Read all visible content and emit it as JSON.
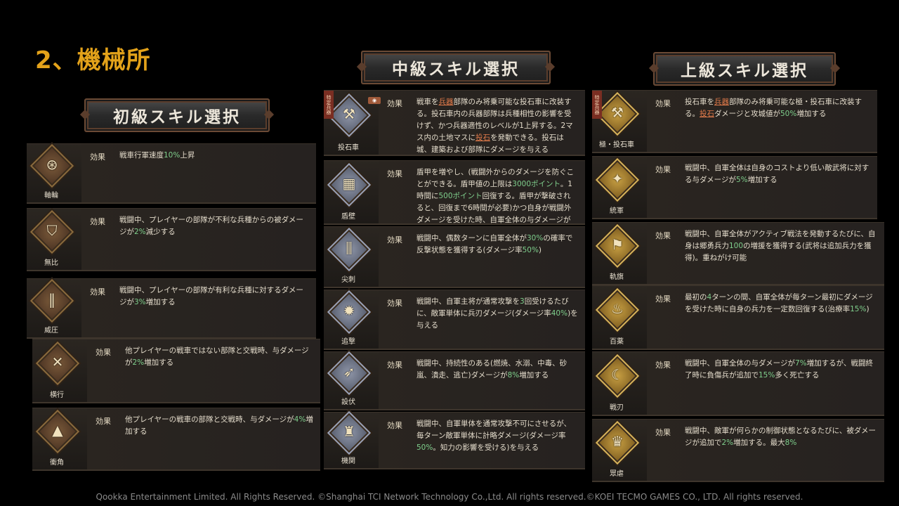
{
  "page_title": "2、機械所",
  "headers": {
    "basic": "初級スキル選択",
    "intermediate": "中級スキル選択",
    "advanced": "上級スキル選択"
  },
  "effect_label": "効果",
  "side_tag": "特定兵器",
  "basic": [
    {
      "name": "軸輪",
      "icon": "wheel-icon",
      "pre": "戦車行軍速度",
      "hl": "10%",
      "post": "上昇"
    },
    {
      "name": "無比",
      "icon": "shield-icon",
      "pre": "戦闘中、プレイヤーの部隊が不利な兵種からの被ダメージが",
      "hl": "2%",
      "post": "減少する"
    },
    {
      "name": "威圧",
      "icon": "double-blade-icon",
      "pre": "戦闘中、プレイヤーの部隊が有利な兵種に対するダメージが",
      "hl": "3%",
      "post": "増加する"
    },
    {
      "name": "横行",
      "icon": "crossed-swords-icon",
      "pre": "他プレイヤーの戦車ではない部隊と交戦時、与ダメージが",
      "hl": "2%",
      "post": "増加する"
    },
    {
      "name": "衝角",
      "icon": "spike-icon",
      "pre": "他プレイヤーの戦車の部隊と交戦時、与ダメージが",
      "hl": "4%",
      "post": "増加する"
    }
  ],
  "intermediate": [
    {
      "name": "投石車",
      "icon": "catapult-icon",
      "parts": [
        "戦車を",
        "兵器",
        "部隊のみ将乗可能な投石車に改装する。投石車内の兵器部隊は兵種相性の影響を受けず、かつ兵器適性のレベルが1上昇する。2マス内の土地マスに",
        "投石",
        "を発動できる。投石は城、建築および部隊にダメージを与える"
      ]
    },
    {
      "name": "盾壁",
      "icon": "shield-wall-icon",
      "parts": [
        "盾甲を増やし、(戦闘外からのダメージを防ぐことができる。盾甲値の上限は",
        "3000ポイント",
        "。1時間に",
        "500ポイント",
        "回復する。盾甲が撃破されると、回復まで6時間が必要)かつ自身が戦闘外ダメージを受けた時、自軍全体の与ダメージが",
        "8%",
        "上昇する"
      ]
    },
    {
      "name": "尖刺",
      "icon": "spikes-icon",
      "parts": [
        "戦闘中、偶数ターンに自軍全体が",
        "30%",
        "の確率で反撃状態を獲得する(ダメージ率",
        "50%",
        ")"
      ]
    },
    {
      "name": "追撃",
      "icon": "pursuit-icon",
      "parts": [
        "戦闘中、自軍主将が通常攻撃を",
        "3",
        "回受けるたびに、敵軍単体に兵刃ダメージ(ダメージ率",
        "40%",
        ")を与える"
      ]
    },
    {
      "name": "設伏",
      "icon": "ambush-icon",
      "parts": [
        "戦闘中、持続性のある(燃焼、水溺、中毒、砂嵐、潰走、逃亡)ダメージが",
        "8%",
        "増加する"
      ]
    },
    {
      "name": "機関",
      "icon": "mechanism-icon",
      "parts": [
        "戦闘中、自軍単体を通常攻撃不可にさせるが、毎ターン敵軍単体に計略ダメージ(ダメージ率",
        "50%",
        "。知力の影響を受ける)を与える"
      ]
    }
  ],
  "advanced": [
    {
      "name": "極・投石車",
      "icon": "elite-catapult-icon",
      "parts": [
        "投石車を",
        "兵器",
        "部隊のみ将乗可能な極・投石車に改装する。",
        "投石",
        "ダメージと攻城値が",
        "50%",
        "増加する"
      ]
    },
    {
      "name": "統軍",
      "icon": "command-icon",
      "parts": [
        "戦闘中、自軍全体は自身のコストより低い敵武将に対する与ダメージが",
        "5%",
        "増加する"
      ]
    },
    {
      "name": "軌旗",
      "icon": "banner-icon",
      "parts": [
        "戦闘中、自軍全体がアクティブ戦法を発動するたびに、自身は郷勇兵力",
        "100",
        "の増援を獲得する(武将は追加兵力を獲得)。重ねがけ可能"
      ]
    },
    {
      "name": "百薬",
      "icon": "medicine-icon",
      "parts": [
        "最初の",
        "4",
        "ターンの間、自軍全体が毎ターン最初にダメージを受けた時に自身の兵力を一定数回復する(治療率",
        "15%",
        ")"
      ]
    },
    {
      "name": "戦刃",
      "icon": "war-blade-icon",
      "parts": [
        "戦闘中、自軍全体の与ダメージが",
        "7%",
        "増加するが、戦闘終了時に負傷兵が追加で",
        "15%",
        "多く死亡する"
      ]
    },
    {
      "name": "眾虐",
      "icon": "cruelty-icon",
      "parts": [
        "戦闘中、敵軍が何らかの制御状態となるたびに、被ダメージが追加で",
        "2%",
        "増加する。最大",
        "8%",
        ""
      ]
    }
  ],
  "footer": "Qookka Entertainment Limited. All Rights Reserved. ©Shanghai TCI Network Technology Co.,Ltd. All rights reserved.©KOEI TECMO GAMES CO., LTD. All rights reserved."
}
